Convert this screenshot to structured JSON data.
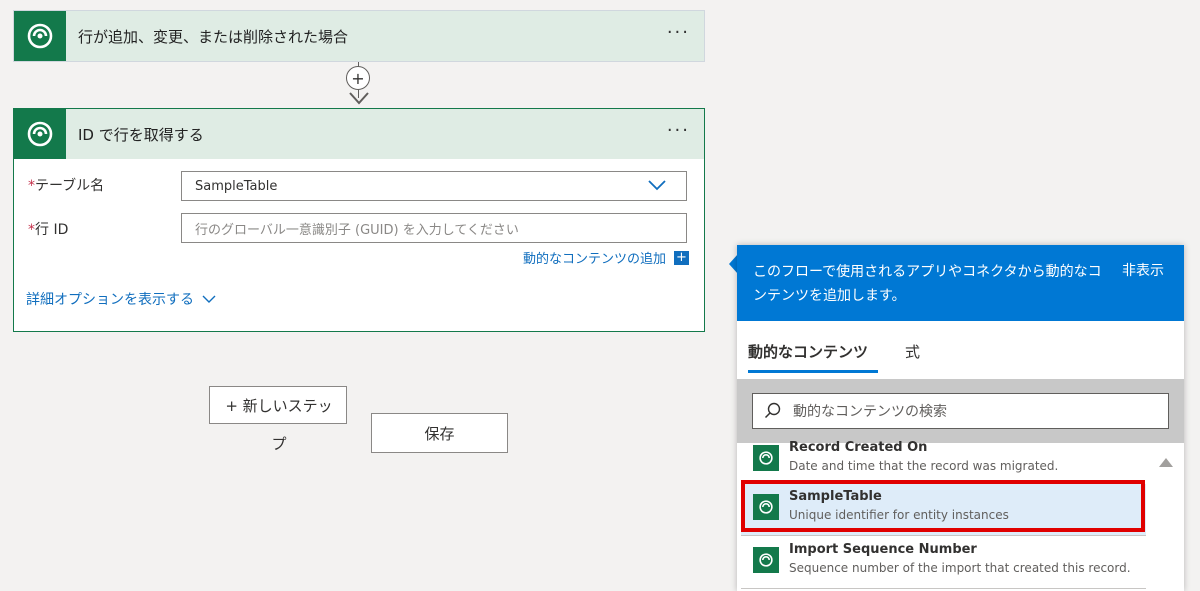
{
  "trigger": {
    "title": "行が追加、変更、または削除された場合",
    "more": "···"
  },
  "connector": {
    "add": "+"
  },
  "action": {
    "title": "ID で行を取得する",
    "more": "···",
    "fields": {
      "table": {
        "required_mark": "*",
        "label": "テーブル名",
        "value": "SampleTable"
      },
      "row": {
        "required_mark": "*",
        "label": "行 ID",
        "placeholder": "行のグローバル一意識別子 (GUID) を入力してください"
      }
    },
    "add_dynamic": "動的なコンテンツの追加",
    "add_dynamic_badge": "+",
    "advanced": "詳細オプションを表示する"
  },
  "buttons": {
    "new_step": "+ 新しいステップ",
    "save": "保存"
  },
  "panel": {
    "description": "このフローで使用されるアプリやコネクタから動的なコンテンツを追加します。",
    "hide": "非表示",
    "tabs": {
      "dynamic": "動的なコンテンツ",
      "expression": "式"
    },
    "search_placeholder": "動的なコンテンツの検索",
    "items": [
      {
        "title": "Record Created On",
        "desc": "Date and time that the record was migrated."
      },
      {
        "title": "SampleTable",
        "desc": "Unique identifier for entity instances"
      },
      {
        "title": "Import Sequence Number",
        "desc": "Sequence number of the import that created this record."
      }
    ]
  },
  "colors": {
    "dataverse_green": "#13794b",
    "header_green": "#dfece4",
    "accent_blue": "#0078d4",
    "link_blue": "#106ebe",
    "highlight_red": "#e00000"
  }
}
